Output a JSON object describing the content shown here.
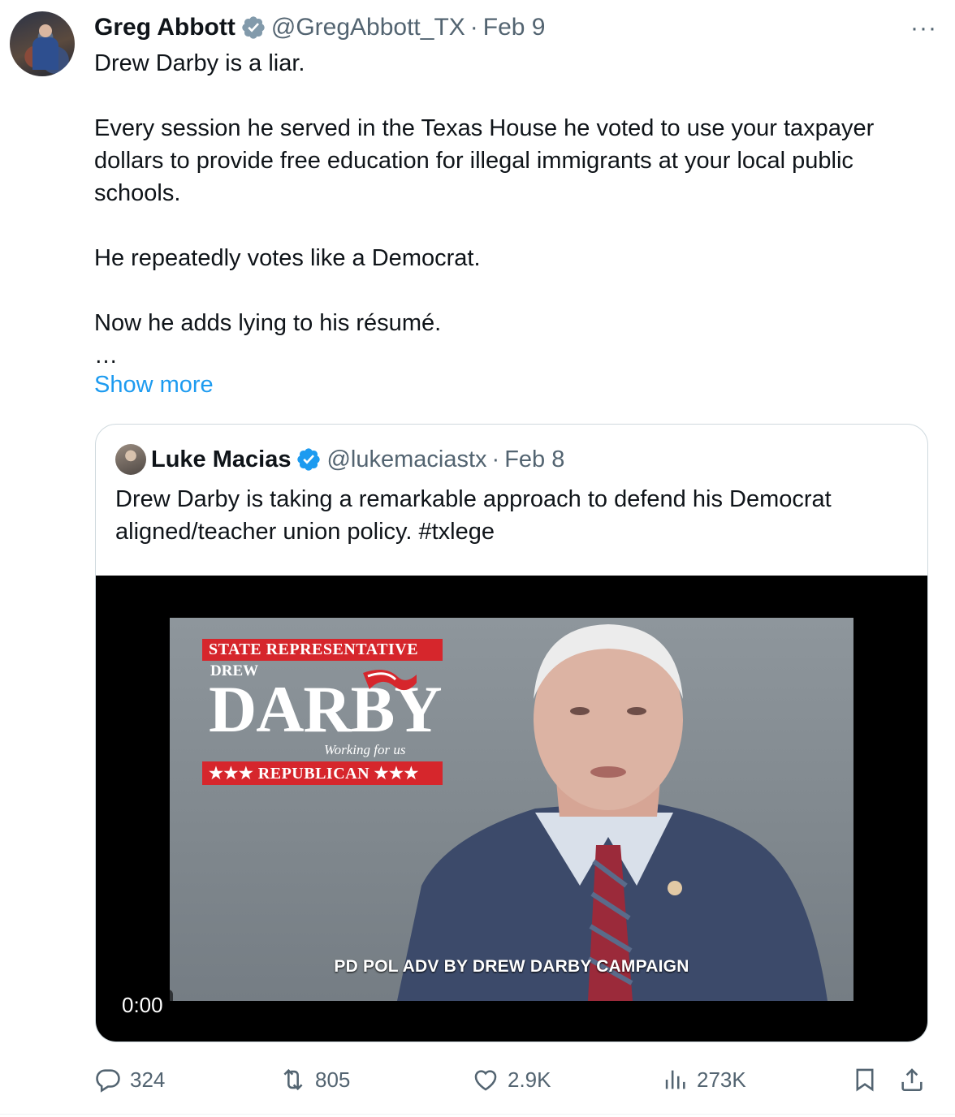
{
  "tweet": {
    "author_name": "Greg Abbott",
    "author_handle": "@GregAbbott_TX",
    "separator": "·",
    "date": "Feb 9",
    "text": "Drew Darby is a liar.\n\nEvery session he served in the Texas House he voted to use your taxpayer dollars to provide free education for illegal immigrants at your local public schools.\n\nHe repeatedly votes like a Democrat.\n\nNow he adds lying to his résumé.\n…",
    "show_more": "Show more",
    "more_icon": "ellipsis-icon",
    "more_label": "···"
  },
  "quote": {
    "author_name": "Luke Macias",
    "author_handle": "@lukemaciastx",
    "separator": "·",
    "date": "Feb 8",
    "text": "Drew Darby is taking a remarkable approach to defend his Democrat aligned/teacher union policy. #txlege",
    "video": {
      "timer": "0:00",
      "logo_top": "STATE REPRESENTATIVE",
      "logo_first": "DREW",
      "logo_last": "DARBY",
      "logo_tagline": "Working for us",
      "logo_party": "★★★ REPUBLICAN ★★★",
      "disclaimer": "PD POL ADV BY DREW DARBY CAMPAIGN"
    }
  },
  "actions": {
    "replies": "324",
    "reposts": "805",
    "likes": "2.9K",
    "views": "273K"
  },
  "colors": {
    "accent": "#1d9bf0",
    "muted": "#536471",
    "text": "#0f1419",
    "logo_red": "#d6262c"
  }
}
